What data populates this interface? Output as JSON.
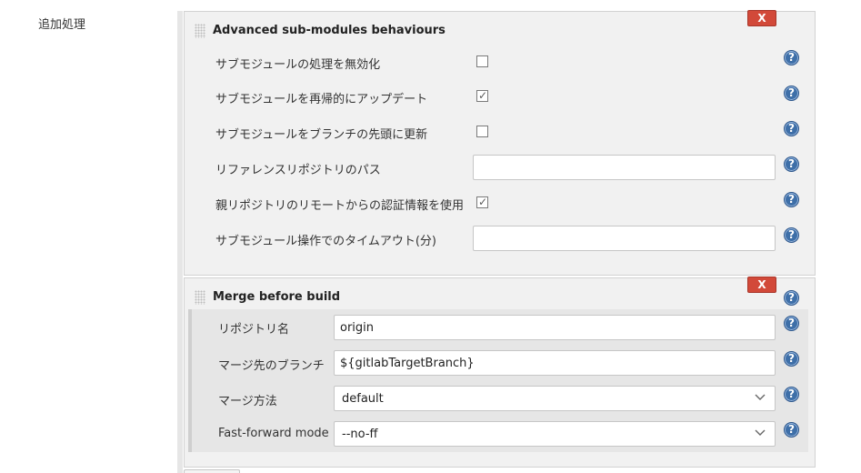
{
  "section": {
    "label": "追加処理"
  },
  "advanced_submodules": {
    "title": "Advanced sub-modules behaviours",
    "delete_label": "X",
    "rows": [
      {
        "label": "サブモジュールの処理を無効化",
        "type": "checkbox",
        "checked": false
      },
      {
        "label": "サブモジュールを再帰的にアップデート",
        "type": "checkbox",
        "checked": true
      },
      {
        "label": "サブモジュールをブランチの先頭に更新",
        "type": "checkbox",
        "checked": false
      },
      {
        "label": "リファレンスリポジトリのパス",
        "type": "text",
        "value": ""
      },
      {
        "label": "親リポジトリのリモートからの認証情報を使用",
        "type": "checkbox",
        "checked": true
      },
      {
        "label": "サブモジュール操作でのタイムアウト(分)",
        "type": "text",
        "value": ""
      }
    ]
  },
  "merge_before_build": {
    "title": "Merge before build",
    "delete_label": "X",
    "fields": [
      {
        "label": "リポジトリ名",
        "type": "text",
        "value": "origin"
      },
      {
        "label": "マージ先のブランチ",
        "type": "text",
        "value": "${gitlabTargetBranch}"
      },
      {
        "label": "マージ方法",
        "type": "select",
        "value": "default"
      },
      {
        "label": "Fast-forward mode",
        "type": "select",
        "value": "--no-ff"
      }
    ]
  },
  "help_label": "?",
  "checkmark": "✓",
  "colors": {
    "delete": "#d24939",
    "help": "#3e6fa8",
    "panel": "#f1f1f1"
  },
  "icons": [
    "drag-handle-icon",
    "delete-x-icon",
    "help-icon",
    "chevron-down-icon",
    "checkmark-icon"
  ]
}
